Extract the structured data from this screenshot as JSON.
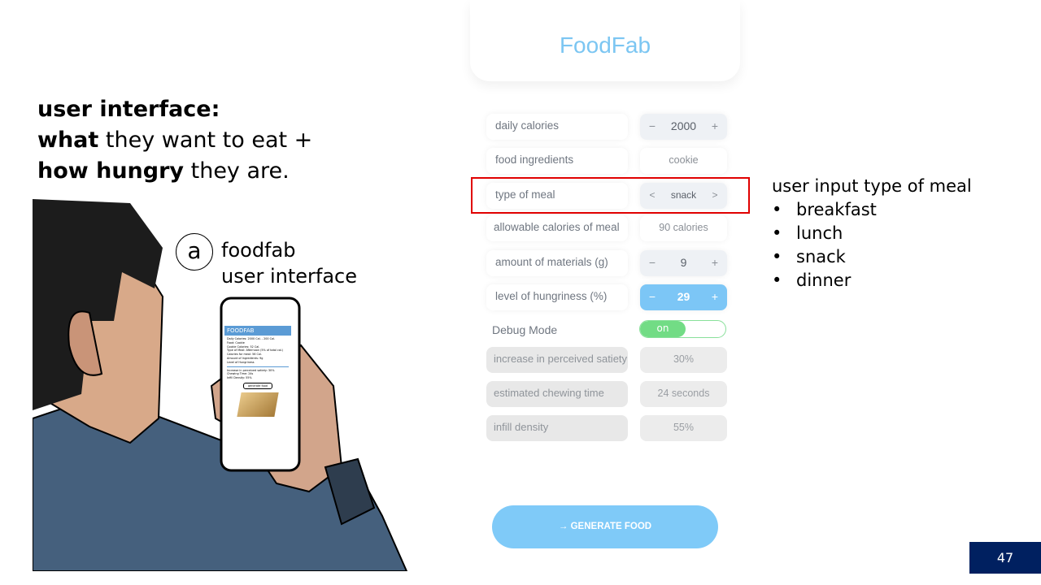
{
  "slide": {
    "heading": {
      "line1_bold": "user interface:",
      "line2_bold": "what",
      "line2_rest": " they want to eat +",
      "line3_bold": "how hungry",
      "line3_rest": " they are."
    },
    "figure_label": "a",
    "figure_caption_1": "foodfab",
    "figure_caption_2": "user interface",
    "phone": {
      "title": "FOODFAB",
      "lines": [
        "Daily Calories: 2000 Cal. - 200 Cal.",
        "Food: Cookie",
        "Cookie Calories: 52 Cal.",
        "Type of Meal: Afternoon (5% of total cal.)",
        "Calories for meal: 56 Cal.",
        "Amount of Ingredients: 9g",
        "Level of Hungriness"
      ],
      "lines2": [
        "Increase in perceived satiety: 30%",
        "Chewing Time: 24s",
        "Infill Density: 55%"
      ],
      "button": "generate food"
    },
    "notes": {
      "title": "user input type of meal",
      "items": [
        "breakfast",
        "lunch",
        "snack",
        "dinner"
      ]
    },
    "page_number": "47"
  },
  "app": {
    "title": "FoodFab",
    "rows": [
      {
        "label": "daily calories",
        "value": "2000",
        "minus": "−",
        "plus": "+"
      },
      {
        "label": "food ingredients",
        "value": "cookie"
      },
      {
        "label": "type of meal",
        "value": "snack",
        "prev": "<",
        "next": ">"
      },
      {
        "label": "allowable calories of meal",
        "value": "90 calories"
      },
      {
        "label": "amount of materials (g)",
        "value": "9",
        "minus": "−",
        "plus": "+"
      },
      {
        "label": "level of hungriness (%)",
        "value": "29",
        "minus": "−",
        "plus": "+"
      }
    ],
    "debug": {
      "label": "Debug Mode",
      "toggle": "on"
    },
    "outputs": [
      {
        "label": "increase in perceived satiety",
        "value": "30%"
      },
      {
        "label": "estimated chewing time",
        "value": "24 seconds"
      },
      {
        "label": "infill density",
        "value": "55%"
      }
    ],
    "generate_button": "→  GENERATE FOOD",
    "colors": {
      "accent": "#7cc6f6",
      "toggle_on": "#72dc85",
      "highlight": "#e00000",
      "page_badge": "#002060"
    }
  }
}
